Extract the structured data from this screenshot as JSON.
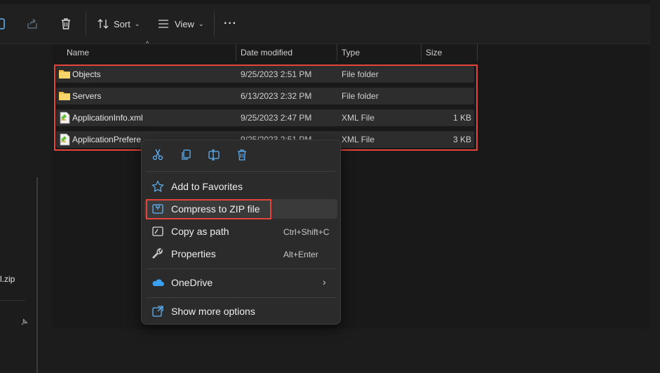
{
  "toolbar": {
    "sort_label": "Sort",
    "view_label": "View",
    "more_label": "···"
  },
  "sidebar": {
    "zip_text": "l.zip"
  },
  "columns": {
    "name": "Name",
    "date": "Date modified",
    "type": "Type",
    "size": "Size"
  },
  "files": [
    {
      "name": "Objects",
      "date": "9/25/2023 2:51 PM",
      "type": "File folder",
      "size": "",
      "icon": "folder-icon"
    },
    {
      "name": "Servers",
      "date": "6/13/2023 2:32 PM",
      "type": "File folder",
      "size": "",
      "icon": "folder-icon"
    },
    {
      "name": "ApplicationInfo.xml",
      "date": "9/25/2023 2:47 PM",
      "type": "XML File",
      "size": "1 KB",
      "icon": "xml-file-icon"
    },
    {
      "name": "ApplicationPrefere",
      "date": "9/25/2023 2:51 PM",
      "type": "XML File",
      "size": "3 KB",
      "icon": "xml-file-icon"
    }
  ],
  "context_menu": {
    "quick_actions": [
      "cut-icon",
      "copy-icon",
      "rename-icon",
      "delete-icon"
    ],
    "items": [
      {
        "label": "Add to Favorites",
        "shortcut": "",
        "icon": "star-icon"
      },
      {
        "label": "Compress to ZIP file",
        "shortcut": "",
        "icon": "zip-icon"
      },
      {
        "label": "Copy as path",
        "shortcut": "Ctrl+Shift+C",
        "icon": "copy-path-icon"
      },
      {
        "label": "Properties",
        "shortcut": "Alt+Enter",
        "icon": "wrench-icon"
      },
      {
        "label": "OneDrive",
        "shortcut": "",
        "icon": "onedrive-icon"
      },
      {
        "label": "Show more options",
        "shortcut": "",
        "icon": "show-more-icon"
      }
    ]
  },
  "colors": {
    "highlight": "#e5443a",
    "folder": "#f0c24a",
    "onedrive": "#3aa0f3",
    "accent_icon": "#5eb2f5"
  }
}
